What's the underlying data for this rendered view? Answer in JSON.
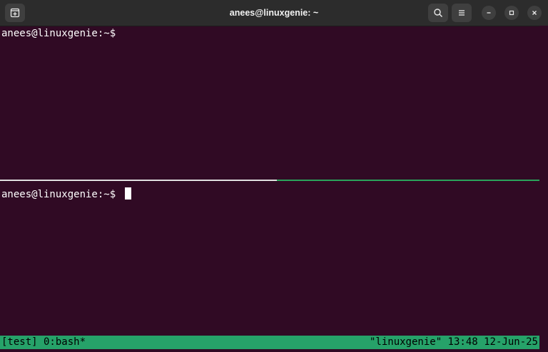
{
  "window": {
    "title": "anees@linuxgenie: ~",
    "buttons": [
      "new-tab-icon",
      "search-icon",
      "menu-icon",
      "minimize-icon",
      "maximize-icon",
      "close-icon"
    ]
  },
  "panes": {
    "top": {
      "prompt": "anees@linuxgenie:~$"
    },
    "bottom": {
      "prompt": "anees@linuxgenie:~$ "
    }
  },
  "status_bar": {
    "left": "[test] 0:bash*",
    "right": "\"linuxgenie\" 13:48 12-Jun-25",
    "color": "#26a269"
  },
  "colors": {
    "terminal_bg": "#300a24",
    "titlebar_bg": "#2c2c2c",
    "active_pane_border": "#2aa35b"
  }
}
